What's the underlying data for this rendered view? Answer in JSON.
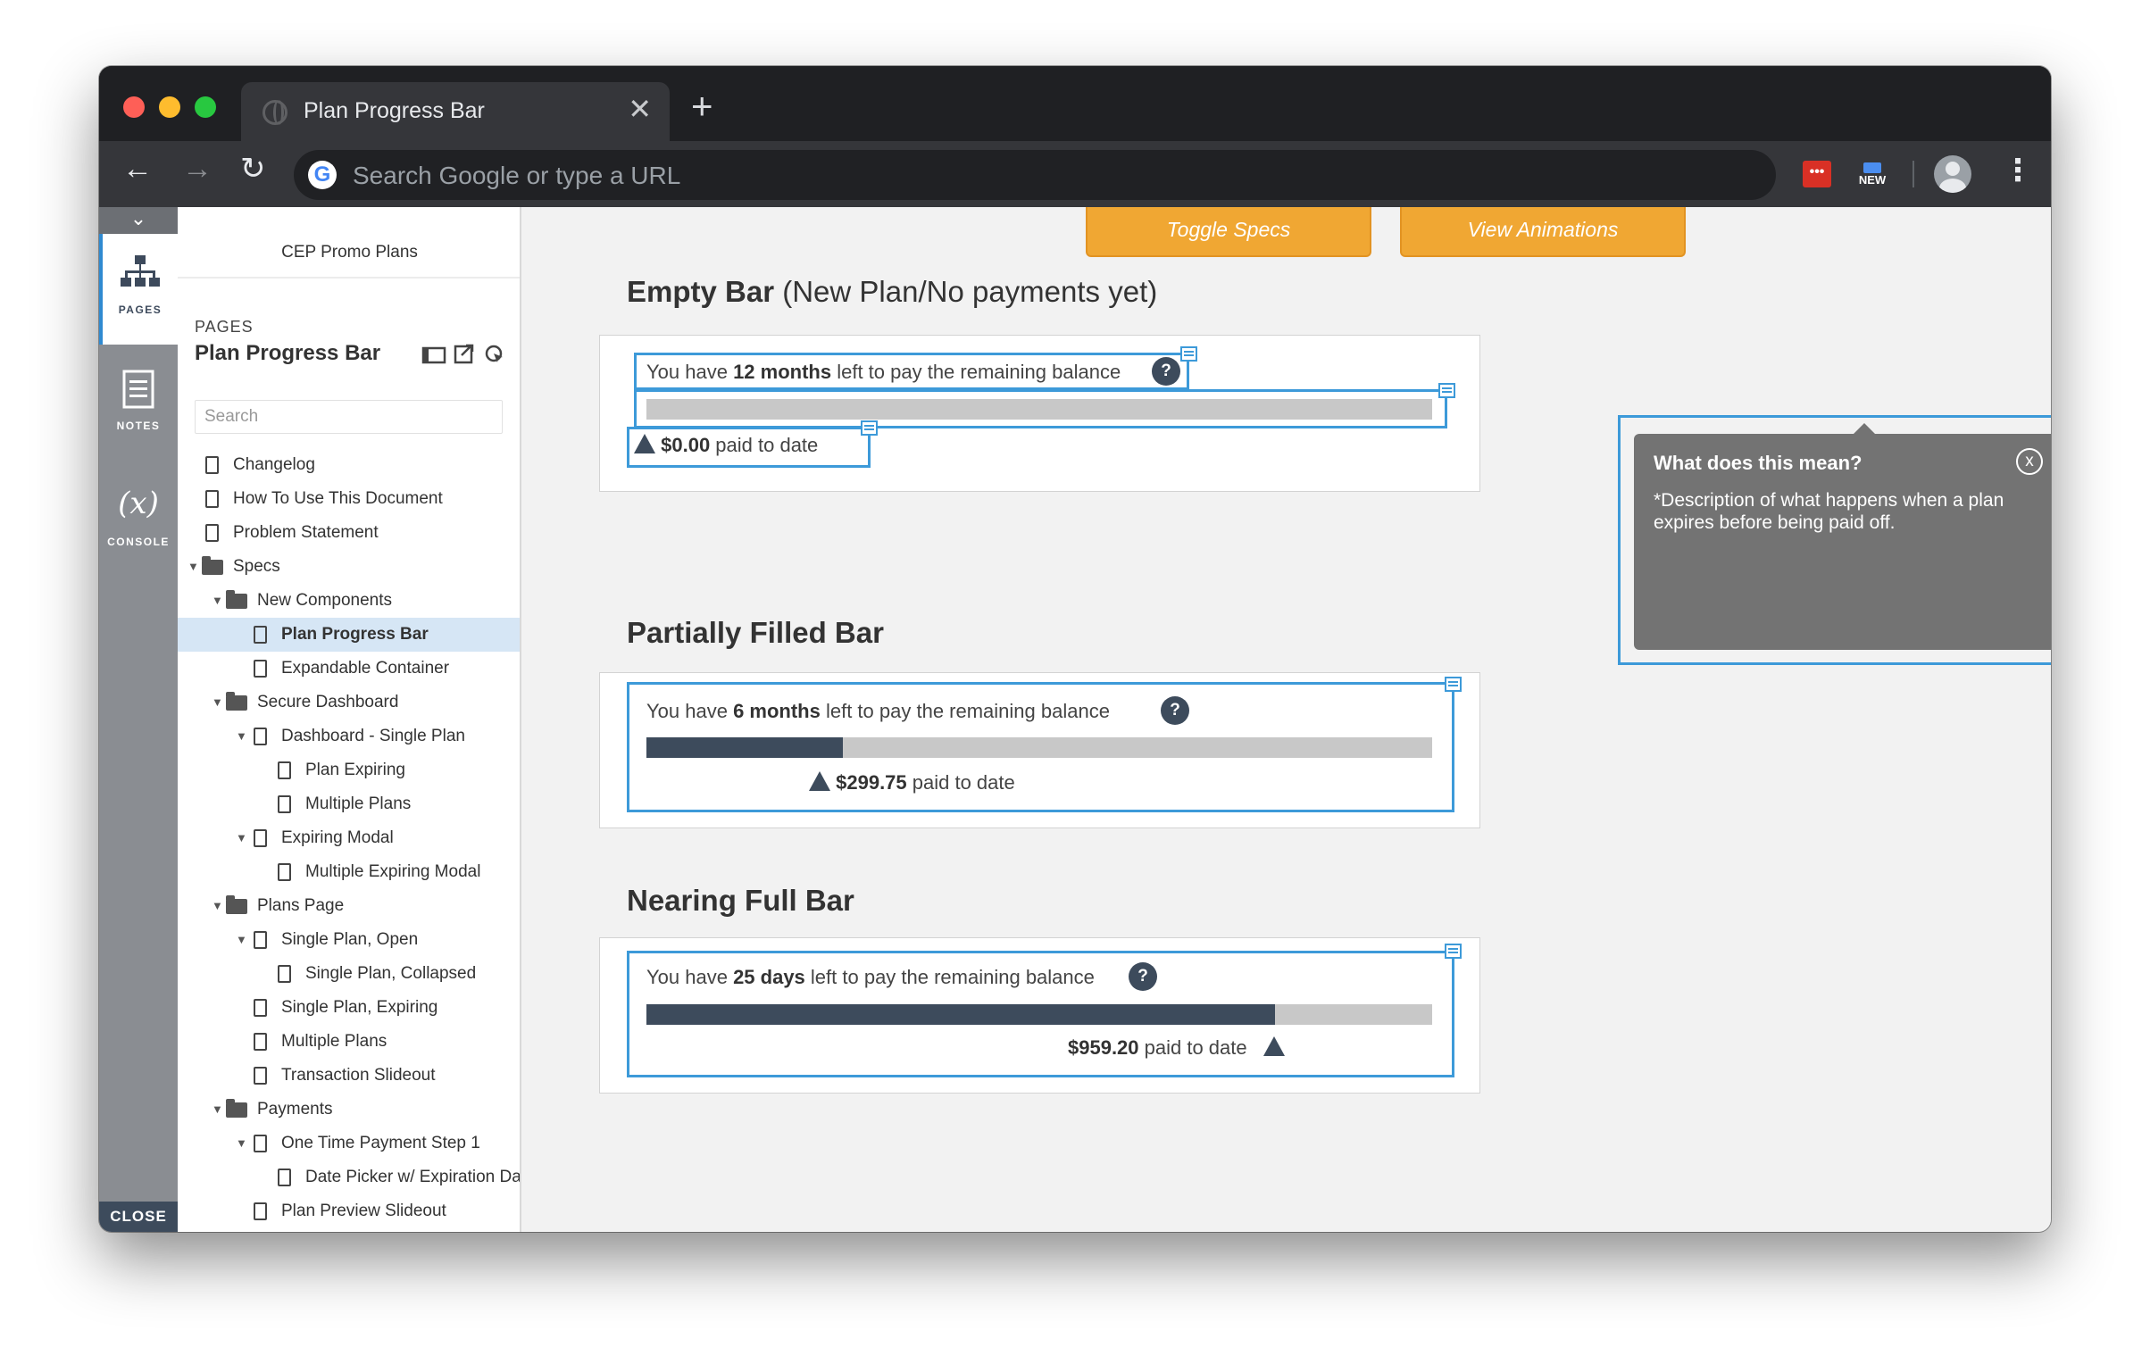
{
  "browser": {
    "tab_title": "Plan Progress Bar",
    "tab_close": "✕",
    "new_tab": "+",
    "omnibox_placeholder": "Search Google or type a URL",
    "google_letter": "G",
    "ext_red_label": "•••",
    "ext_new_label": "NEW"
  },
  "rail": {
    "collapse": "⌄",
    "items": [
      {
        "label": "PAGES",
        "icon": "sitemap-icon"
      },
      {
        "label": "NOTES",
        "icon": "notes-icon"
      },
      {
        "label": "CONSOLE",
        "icon": "variable-icon",
        "glyph": "(x)"
      }
    ],
    "close_label": "CLOSE"
  },
  "sitemap": {
    "project_title": "CEP Promo Plans",
    "pages_label": "PAGES",
    "current_page": "Plan Progress Bar",
    "search_placeholder": "Search",
    "tree": [
      {
        "label": "Changelog",
        "type": "page",
        "depth": 0
      },
      {
        "label": "How To Use This Document",
        "type": "page",
        "depth": 0
      },
      {
        "label": "Problem Statement",
        "type": "page",
        "depth": 0
      },
      {
        "label": "Specs",
        "type": "folder",
        "depth": 0,
        "expanded": true
      },
      {
        "label": "New Components",
        "type": "folder",
        "depth": 1,
        "expanded": true
      },
      {
        "label": "Plan Progress Bar",
        "type": "page",
        "depth": 2,
        "selected": true
      },
      {
        "label": "Expandable Container",
        "type": "page",
        "depth": 2
      },
      {
        "label": "Secure Dashboard",
        "type": "folder",
        "depth": 1,
        "expanded": true
      },
      {
        "label": "Dashboard - Single Plan",
        "type": "page",
        "depth": 2,
        "expanded": true
      },
      {
        "label": "Plan Expiring",
        "type": "page",
        "depth": 3
      },
      {
        "label": "Multiple Plans",
        "type": "page",
        "depth": 3
      },
      {
        "label": "Expiring Modal",
        "type": "page",
        "depth": 2,
        "expanded": true
      },
      {
        "label": "Multiple Expiring Modal",
        "type": "page",
        "depth": 3
      },
      {
        "label": "Plans Page",
        "type": "folder",
        "depth": 1,
        "expanded": true
      },
      {
        "label": "Single Plan, Open",
        "type": "page",
        "depth": 2,
        "expanded": true
      },
      {
        "label": "Single Plan, Collapsed",
        "type": "page",
        "depth": 3
      },
      {
        "label": "Single Plan, Expiring",
        "type": "page",
        "depth": 2
      },
      {
        "label": "Multiple Plans",
        "type": "page",
        "depth": 2
      },
      {
        "label": "Transaction Slideout",
        "type": "page",
        "depth": 2
      },
      {
        "label": "Payments",
        "type": "folder",
        "depth": 1,
        "expanded": true
      },
      {
        "label": "One Time Payment Step 1",
        "type": "page",
        "depth": 2,
        "expanded": true
      },
      {
        "label": "Date Picker w/ Expiration Date",
        "type": "page",
        "depth": 3
      },
      {
        "label": "Plan Preview Slideout",
        "type": "page",
        "depth": 2
      }
    ]
  },
  "toolbar_buttons": {
    "toggle_specs": "Toggle Specs",
    "view_animations": "View Animations"
  },
  "sections": [
    {
      "title": "Empty Bar",
      "subtitle": "(New Plan/No payments yet)",
      "prefix": "You have ",
      "remaining": "12 months",
      "suffix": " left to pay the remaining balance",
      "help": "?",
      "progress": 0.0,
      "amount": "$0.00",
      "paid_suffix": " paid to date"
    },
    {
      "title": "Partially Filled Bar",
      "subtitle": "",
      "prefix": "You have ",
      "remaining": "6 months",
      "suffix": " left to pay the remaining balance",
      "help": "?",
      "progress": 0.25,
      "amount": "$299.75",
      "paid_suffix": " paid to date"
    },
    {
      "title": "Nearing Full Bar",
      "subtitle": "",
      "prefix": "You have ",
      "remaining": "25 days",
      "suffix": " left to pay the remaining balance",
      "help": "?",
      "progress": 0.8,
      "amount": "$959.20",
      "paid_suffix": " paid to date"
    }
  ],
  "tooltip": {
    "title": "What does this mean?",
    "close": "x",
    "body": "*Description of what happens when a plan expires before being paid off."
  },
  "colors": {
    "accent_orange": "#f0a733",
    "bar_fill": "#3d4b5c",
    "bar_track": "#c8c8c8",
    "spec_highlight": "#3d9ad9",
    "tooltip_bg": "#737373"
  }
}
